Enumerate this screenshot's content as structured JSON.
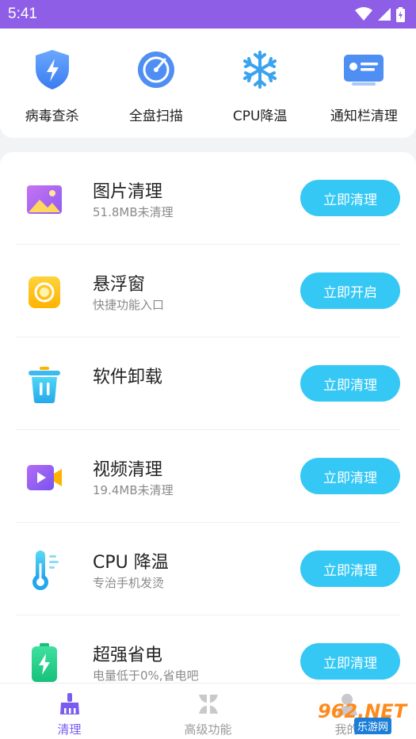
{
  "status_bar": {
    "time": "5:41"
  },
  "quick_actions": [
    {
      "label": "病毒查杀",
      "icon": "shield-lightning-icon"
    },
    {
      "label": "全盘扫描",
      "icon": "radar-scan-icon"
    },
    {
      "label": "CPU降温",
      "icon": "snowflake-icon"
    },
    {
      "label": "通知栏清理",
      "icon": "notification-card-icon"
    }
  ],
  "items": [
    {
      "title": "图片清理",
      "subtitle": "51.8MB未清理",
      "button": "立即清理",
      "icon": "image-icon"
    },
    {
      "title": "悬浮窗",
      "subtitle": "快捷功能入口",
      "button": "立即开启",
      "icon": "floating-window-icon"
    },
    {
      "title": "软件卸载",
      "subtitle": "",
      "button": "立即清理",
      "icon": "trash-icon"
    },
    {
      "title": "视频清理",
      "subtitle": "19.4MB未清理",
      "button": "立即清理",
      "icon": "video-icon"
    },
    {
      "title": "CPU 降温",
      "subtitle": "专治手机发烫",
      "button": "立即清理",
      "icon": "thermometer-icon"
    },
    {
      "title": "超强省电",
      "subtitle": "电量低于0%,省电吧",
      "button": "立即清理",
      "icon": "battery-icon"
    }
  ],
  "tabs": [
    {
      "label": "清理",
      "icon": "broom-icon",
      "active": true
    },
    {
      "label": "高级功能",
      "icon": "grid-icon",
      "active": false
    },
    {
      "label": "我的",
      "icon": "user-icon",
      "active": false
    }
  ],
  "watermark": {
    "number": "962.NET",
    "site": "乐游网"
  },
  "colors": {
    "status_bar": "#8e5fe6",
    "button": "#35c8f5",
    "active_tab": "#7b5cf0"
  }
}
